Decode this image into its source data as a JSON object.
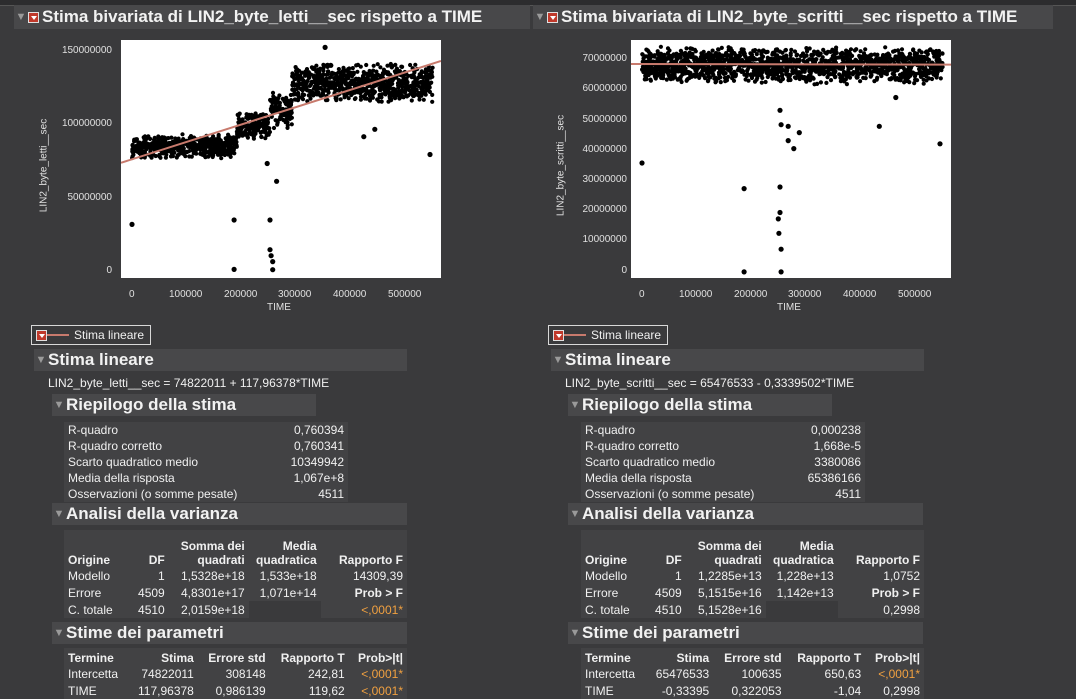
{
  "left": {
    "title": "Stima bivariata di LIN2_byte_letti__sec rispetto a TIME",
    "ylabel": "LIN2_byte_letti__sec",
    "xlabel": "TIME",
    "yticks": [
      "150000000",
      "100000000",
      "50000000",
      "0"
    ],
    "xticks": [
      "0",
      "100000",
      "200000",
      "300000",
      "400000",
      "500000"
    ],
    "legend_label": "Stima lineare",
    "fit_title": "Stima lineare",
    "equation": "LIN2_byte_letti__sec = 74822011 + 117,96378*TIME",
    "summary": {
      "title": "Riepilogo della stima",
      "rows": [
        {
          "label": "R-quadro",
          "value": "0,760394"
        },
        {
          "label": "R-quadro corretto",
          "value": "0,760341"
        },
        {
          "label": "Scarto quadratico medio",
          "value": "10349942"
        },
        {
          "label": "Media della risposta",
          "value": "1,067e+8"
        },
        {
          "label": "Osservazioni (o somme pesate)",
          "value": "4511"
        }
      ]
    },
    "anova": {
      "title": "Analisi della varianza",
      "headers": [
        "Origine",
        "DF",
        "Somma dei quadrati",
        "Media quadratica",
        "Rapporto F"
      ],
      "rows": [
        {
          "origine": "Modello",
          "df": "1",
          "ss": "1,5328e+18",
          "ms": "1,533e+18",
          "f": "14309,39"
        },
        {
          "origine": "Errore",
          "df": "4509",
          "ss": "4,8301e+17",
          "ms": "1,071e+14",
          "f": "Prob > F"
        },
        {
          "origine": "C. totale",
          "df": "4510",
          "ss": "2,0159e+18",
          "ms": "",
          "f": "<,0001*"
        }
      ]
    },
    "params": {
      "title": "Stime dei parametri",
      "headers": [
        "Termine",
        "Stima",
        "Errore std",
        "Rapporto T",
        "Prob>|t|"
      ],
      "rows": [
        {
          "termine": "Intercetta",
          "stima": "74822011",
          "err": "308148",
          "t": "242,81",
          "p": "<,0001*"
        },
        {
          "termine": "TIME",
          "stima": "117,96378",
          "err": "0,986139",
          "t": "119,62",
          "p": "<,0001*"
        }
      ]
    }
  },
  "right": {
    "title": "Stima bivariata di LIN2_byte_scritti__sec rispetto a TIME",
    "ylabel": "LIN2_byte_scritti__sec",
    "xlabel": "TIME",
    "yticks": [
      "70000000",
      "60000000",
      "50000000",
      "40000000",
      "30000000",
      "20000000",
      "10000000",
      "0"
    ],
    "xticks": [
      "0",
      "100000",
      "200000",
      "300000",
      "400000",
      "500000"
    ],
    "legend_label": "Stima lineare",
    "fit_title": "Stima lineare",
    "equation": "LIN2_byte_scritti__sec = 65476533 - 0,3339502*TIME",
    "summary": {
      "title": "Riepilogo della stima",
      "rows": [
        {
          "label": "R-quadro",
          "value": "0,000238"
        },
        {
          "label": "R-quadro corretto",
          "value": "1,668e-5"
        },
        {
          "label": "Scarto quadratico medio",
          "value": "3380086"
        },
        {
          "label": "Media della risposta",
          "value": "65386166"
        },
        {
          "label": "Osservazioni (o somme pesate)",
          "value": "4511"
        }
      ]
    },
    "anova": {
      "title": "Analisi della varianza",
      "headers": [
        "Origine",
        "DF",
        "Somma dei quadrati",
        "Media quadratica",
        "Rapporto F"
      ],
      "rows": [
        {
          "origine": "Modello",
          "df": "1",
          "ss": "1,2285e+13",
          "ms": "1,228e+13",
          "f": "1,0752"
        },
        {
          "origine": "Errore",
          "df": "4509",
          "ss": "5,1515e+16",
          "ms": "1,142e+13",
          "f": "Prob > F"
        },
        {
          "origine": "C. totale",
          "df": "4510",
          "ss": "5,1528e+16",
          "ms": "",
          "f": "0,2998"
        }
      ]
    },
    "params": {
      "title": "Stime dei parametri",
      "headers": [
        "Termine",
        "Stima",
        "Errore std",
        "Rapporto T",
        "Prob>|t|"
      ],
      "rows": [
        {
          "termine": "Intercetta",
          "stima": "65476533",
          "err": "100635",
          "t": "650,63",
          "p": "<,0001*"
        },
        {
          "termine": "TIME",
          "stima": "-0,33395",
          "err": "0,322053",
          "t": "-1,04",
          "p": "0,2998"
        }
      ]
    }
  },
  "chart_data": [
    {
      "type": "scatter",
      "xlabel": "TIME",
      "ylabel": "LIN2_byte_letti__sec",
      "xlim": [
        -20000,
        560000
      ],
      "ylim": [
        -5000000,
        155000000
      ],
      "fit": {
        "intercept": 74822011,
        "slope": 117.96378
      },
      "segments": [
        {
          "x0": 0,
          "x1": 190000,
          "ymin": 75000000,
          "ymax": 92000000
        },
        {
          "x0": 190000,
          "x1": 250000,
          "ymin": 88000000,
          "ymax": 107000000
        },
        {
          "x0": 250000,
          "x1": 290000,
          "ymin": 95000000,
          "ymax": 120000000
        },
        {
          "x0": 290000,
          "x1": 545000,
          "ymin": 112000000,
          "ymax": 140000000
        }
      ],
      "outliers": [
        [
          0,
          31000000
        ],
        [
          185000,
          34000000
        ],
        [
          185000,
          800000
        ],
        [
          250000,
          34000000
        ],
        [
          250000,
          14000000
        ],
        [
          252000,
          10000000
        ],
        [
          255000,
          6000000
        ],
        [
          255000,
          600000
        ],
        [
          245000,
          72000000
        ],
        [
          262000,
          60000000
        ],
        [
          360000,
          138000000
        ],
        [
          420000,
          90000000
        ],
        [
          440000,
          95000000
        ],
        [
          540000,
          78000000
        ],
        [
          350000,
          150000000
        ]
      ],
      "fit_color": "#c87a6d"
    },
    {
      "type": "scatter",
      "xlabel": "TIME",
      "ylabel": "LIN2_byte_scritti__sec",
      "xlim": [
        -20000,
        560000
      ],
      "ylim": [
        -1500000,
        73000000
      ],
      "fit": {
        "intercept": 65476533,
        "slope": -0.3339502
      },
      "segments": [
        {
          "x0": 0,
          "x1": 545000,
          "ymin": 59000000,
          "ymax": 71000000
        }
      ],
      "outliers": [
        [
          0,
          34500000
        ],
        [
          185000,
          26500000
        ],
        [
          185000,
          400000
        ],
        [
          250000,
          51000000
        ],
        [
          252000,
          46500000
        ],
        [
          265000,
          46000000
        ],
        [
          265000,
          41500000
        ],
        [
          275000,
          39000000
        ],
        [
          285000,
          44000000
        ],
        [
          250000,
          27000000
        ],
        [
          250000,
          19000000
        ],
        [
          247000,
          17000000
        ],
        [
          248000,
          12500000
        ],
        [
          252000,
          7500000
        ],
        [
          252000,
          400000
        ],
        [
          430000,
          46000000
        ],
        [
          460000,
          55000000
        ],
        [
          540000,
          40500000
        ]
      ],
      "fit_color": "#c87a6d"
    }
  ]
}
